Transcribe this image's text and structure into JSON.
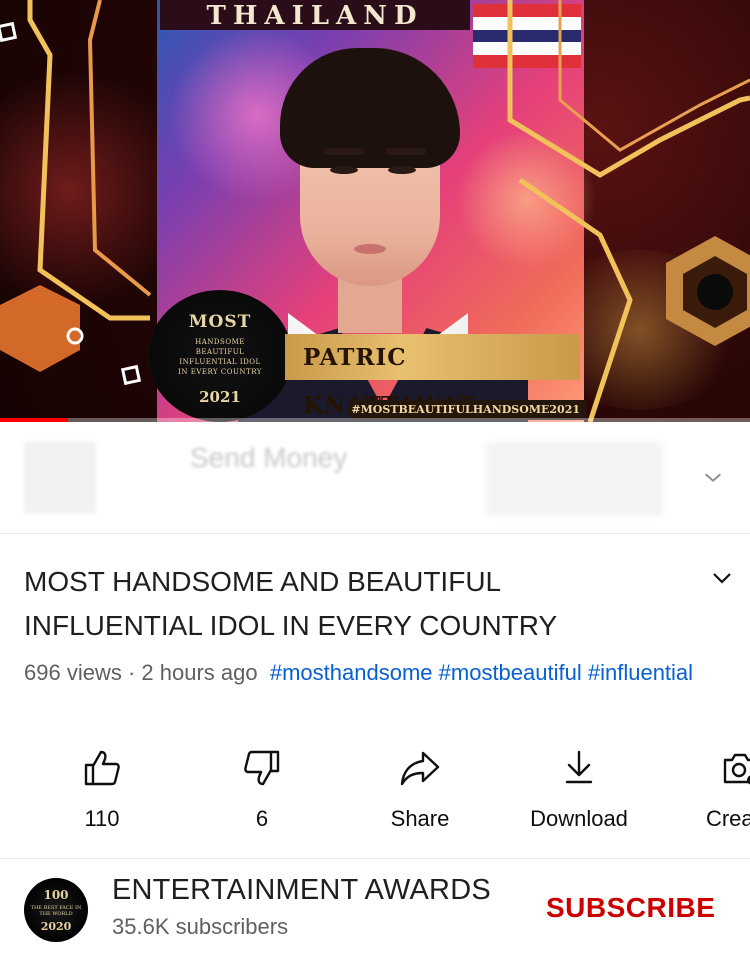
{
  "video": {
    "thumbnail": {
      "country": "THAILAND",
      "name_banner": "PATRIC KNATTAWAT",
      "hashtag_banner": "#MOSTBEAUTIFULHANDSOME2021",
      "badge": {
        "most": "MOST",
        "line1": "HANDSOME",
        "line2": "BEAUTIFUL",
        "line3": "INFLUENTIAL IDOL",
        "line4": "IN EVERY COUNTRY",
        "year": "2021"
      },
      "flag_colors": [
        "#e0303a",
        "#ffffff",
        "#2a2a6e",
        "#ffffff",
        "#e0303a"
      ]
    },
    "progress_fraction": 0.09
  },
  "ad": {
    "text": "Send Money"
  },
  "details": {
    "title": "MOST HANDSOME AND BEAUTIFUL INFLUENTIAL IDOL IN EVERY COUNTRY",
    "views": "696 views",
    "separator": "·",
    "time": "2 hours ago",
    "tags": [
      "#mosthandsome",
      "#mostbeautiful",
      "#influential"
    ]
  },
  "actions": [
    {
      "icon": "thumbs-up-icon",
      "label": "110"
    },
    {
      "icon": "thumbs-down-icon",
      "label": "6"
    },
    {
      "icon": "share-icon",
      "label": "Share"
    },
    {
      "icon": "download-icon",
      "label": "Download"
    },
    {
      "icon": "create-icon",
      "label": "Create"
    }
  ],
  "channel": {
    "avatar": {
      "top": "100",
      "middle": "THE BEST FACE IN THE WORLD",
      "bottom": "2020"
    },
    "name": "ENTERTAINMENT AWARDS",
    "subscribers": "35.6K subscribers",
    "subscribe_label": "SUBSCRIBE"
  },
  "colors": {
    "link": "#065fd4",
    "subscribe": "#cc0000",
    "progress": "#ff0000",
    "hex_gold": "#f2c25a"
  }
}
